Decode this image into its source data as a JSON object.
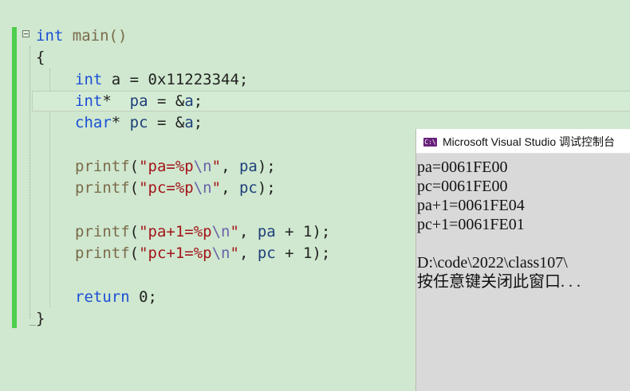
{
  "editor": {
    "lines": [
      [
        {
          "t": "int",
          "c": "kw"
        },
        {
          "t": " main()",
          "c": "fn"
        }
      ],
      [
        {
          "t": "{",
          "c": "plain"
        }
      ],
      [
        {
          "t": "int",
          "c": "kw"
        },
        {
          "t": " a = 0x11223344;",
          "c": "plain"
        }
      ],
      [
        {
          "t": "int",
          "c": "kw"
        },
        {
          "t": "*  ",
          "c": "plain"
        },
        {
          "t": "pa",
          "c": "id"
        },
        {
          "t": " = &",
          "c": "plain"
        },
        {
          "t": "a",
          "c": "id"
        },
        {
          "t": ";",
          "c": "plain"
        }
      ],
      [
        {
          "t": "char",
          "c": "kw"
        },
        {
          "t": "* ",
          "c": "plain"
        },
        {
          "t": "pc",
          "c": "id"
        },
        {
          "t": " = &",
          "c": "plain"
        },
        {
          "t": "a",
          "c": "id"
        },
        {
          "t": ";",
          "c": "plain"
        }
      ],
      [],
      [
        {
          "t": "printf",
          "c": "fn"
        },
        {
          "t": "(",
          "c": "plain"
        },
        {
          "t": "\"pa=%p",
          "c": "str"
        },
        {
          "t": "\\n",
          "c": "esc"
        },
        {
          "t": "\"",
          "c": "str"
        },
        {
          "t": ", ",
          "c": "plain"
        },
        {
          "t": "pa",
          "c": "id"
        },
        {
          "t": ");",
          "c": "plain"
        }
      ],
      [
        {
          "t": "printf",
          "c": "fn"
        },
        {
          "t": "(",
          "c": "plain"
        },
        {
          "t": "\"pc=%p",
          "c": "str"
        },
        {
          "t": "\\n",
          "c": "esc"
        },
        {
          "t": "\"",
          "c": "str"
        },
        {
          "t": ", ",
          "c": "plain"
        },
        {
          "t": "pc",
          "c": "id"
        },
        {
          "t": ");",
          "c": "plain"
        }
      ],
      [],
      [
        {
          "t": "printf",
          "c": "fn"
        },
        {
          "t": "(",
          "c": "plain"
        },
        {
          "t": "\"pa+1=%p",
          "c": "str"
        },
        {
          "t": "\\n",
          "c": "esc"
        },
        {
          "t": "\"",
          "c": "str"
        },
        {
          "t": ", ",
          "c": "plain"
        },
        {
          "t": "pa",
          "c": "id"
        },
        {
          "t": " + 1);",
          "c": "plain"
        }
      ],
      [
        {
          "t": "printf",
          "c": "fn"
        },
        {
          "t": "(",
          "c": "plain"
        },
        {
          "t": "\"pc+1=%p",
          "c": "str"
        },
        {
          "t": "\\n",
          "c": "esc"
        },
        {
          "t": "\"",
          "c": "str"
        },
        {
          "t": ", ",
          "c": "plain"
        },
        {
          "t": "pc",
          "c": "id"
        },
        {
          "t": " + 1);",
          "c": "plain"
        }
      ],
      [],
      [
        {
          "t": "return",
          "c": "kw"
        },
        {
          "t": " 0;",
          "c": "plain"
        }
      ],
      [
        {
          "t": "}",
          "c": "plain"
        }
      ]
    ]
  },
  "console": {
    "icon_label": "C:\\",
    "title": "Microsoft Visual Studio 调试控制台",
    "output": [
      "pa=0061FE00",
      "pc=0061FE00",
      "pa+1=0061FE04",
      "pc+1=0061FE01",
      "",
      "D:\\code\\2022\\class107\\",
      "按任意键关闭此窗口. . ."
    ]
  }
}
